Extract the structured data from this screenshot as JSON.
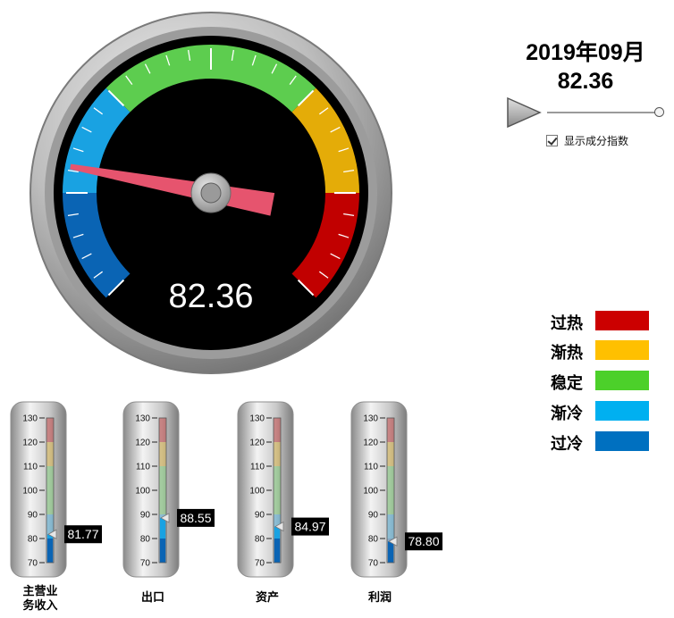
{
  "gauge": {
    "value": 82.36,
    "value_text": "82.36",
    "min": 70,
    "max": 130,
    "bands": [
      {
        "name": "过冷",
        "from": 70,
        "to": 80,
        "color": "#0a64b4"
      },
      {
        "name": "渐冷",
        "from": 80,
        "to": 90,
        "color": "#19a2e2"
      },
      {
        "name": "稳定",
        "from": 90,
        "to": 110,
        "color": "#5dcd4f"
      },
      {
        "name": "渐热",
        "from": 110,
        "to": 120,
        "color": "#e4ac08"
      },
      {
        "name": "过热",
        "from": 120,
        "to": 130,
        "color": "#c10000"
      }
    ],
    "needle_color": "#e6546e"
  },
  "header": {
    "period": "2019年09月",
    "value": "82.36"
  },
  "controls": {
    "play_icon": "play-icon",
    "slider_position": 1.0,
    "show_index_label": "显示成分指数",
    "show_index_checked": true
  },
  "legend": {
    "items": [
      {
        "label": "过热",
        "color": "#cc0000"
      },
      {
        "label": "渐热",
        "color": "#ffc000"
      },
      {
        "label": "稳定",
        "color": "#4cd02a"
      },
      {
        "label": "渐冷",
        "color": "#00b0f0"
      },
      {
        "label": "过冷",
        "color": "#0070c0"
      }
    ]
  },
  "thermometers": {
    "ticks": [
      "130",
      "120",
      "110",
      "100",
      "90",
      "80",
      "70"
    ],
    "min": 70,
    "max": 130,
    "items": [
      {
        "label_lines": [
          "主营业",
          "务收入"
        ],
        "value": 81.77,
        "value_text": "81.77"
      },
      {
        "label_lines": [
          "出口"
        ],
        "value": 88.55,
        "value_text": "88.55"
      },
      {
        "label_lines": [
          "资产"
        ],
        "value": 84.97,
        "value_text": "84.97"
      },
      {
        "label_lines": [
          "利润"
        ],
        "value": 78.8,
        "value_text": "78.80"
      }
    ]
  }
}
